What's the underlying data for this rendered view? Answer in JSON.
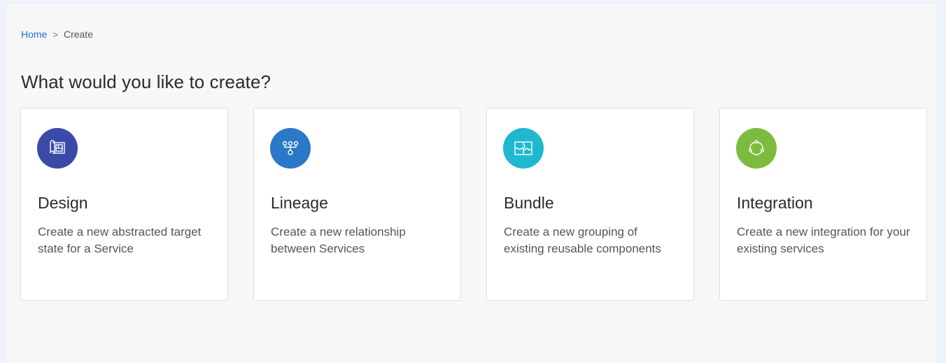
{
  "breadcrumb": {
    "home": "Home",
    "separator": ">",
    "current": "Create"
  },
  "heading": "What would you like to create?",
  "cards": [
    {
      "title": "Design",
      "description": "Create a new abstracted target state for a Service",
      "icon": "blueprint-icon",
      "color": "#3b4aa8"
    },
    {
      "title": "Lineage",
      "description": "Create a new relationship between Services",
      "icon": "hierarchy-icon",
      "color": "#2a78c7"
    },
    {
      "title": "Bundle",
      "description": "Create a new grouping of existing reusable components",
      "icon": "puzzle-icon",
      "color": "#1fb8cf"
    },
    {
      "title": "Integration",
      "description": "Create a new integration for your existing services",
      "icon": "cycle-icon",
      "color": "#7dbb3f"
    }
  ]
}
